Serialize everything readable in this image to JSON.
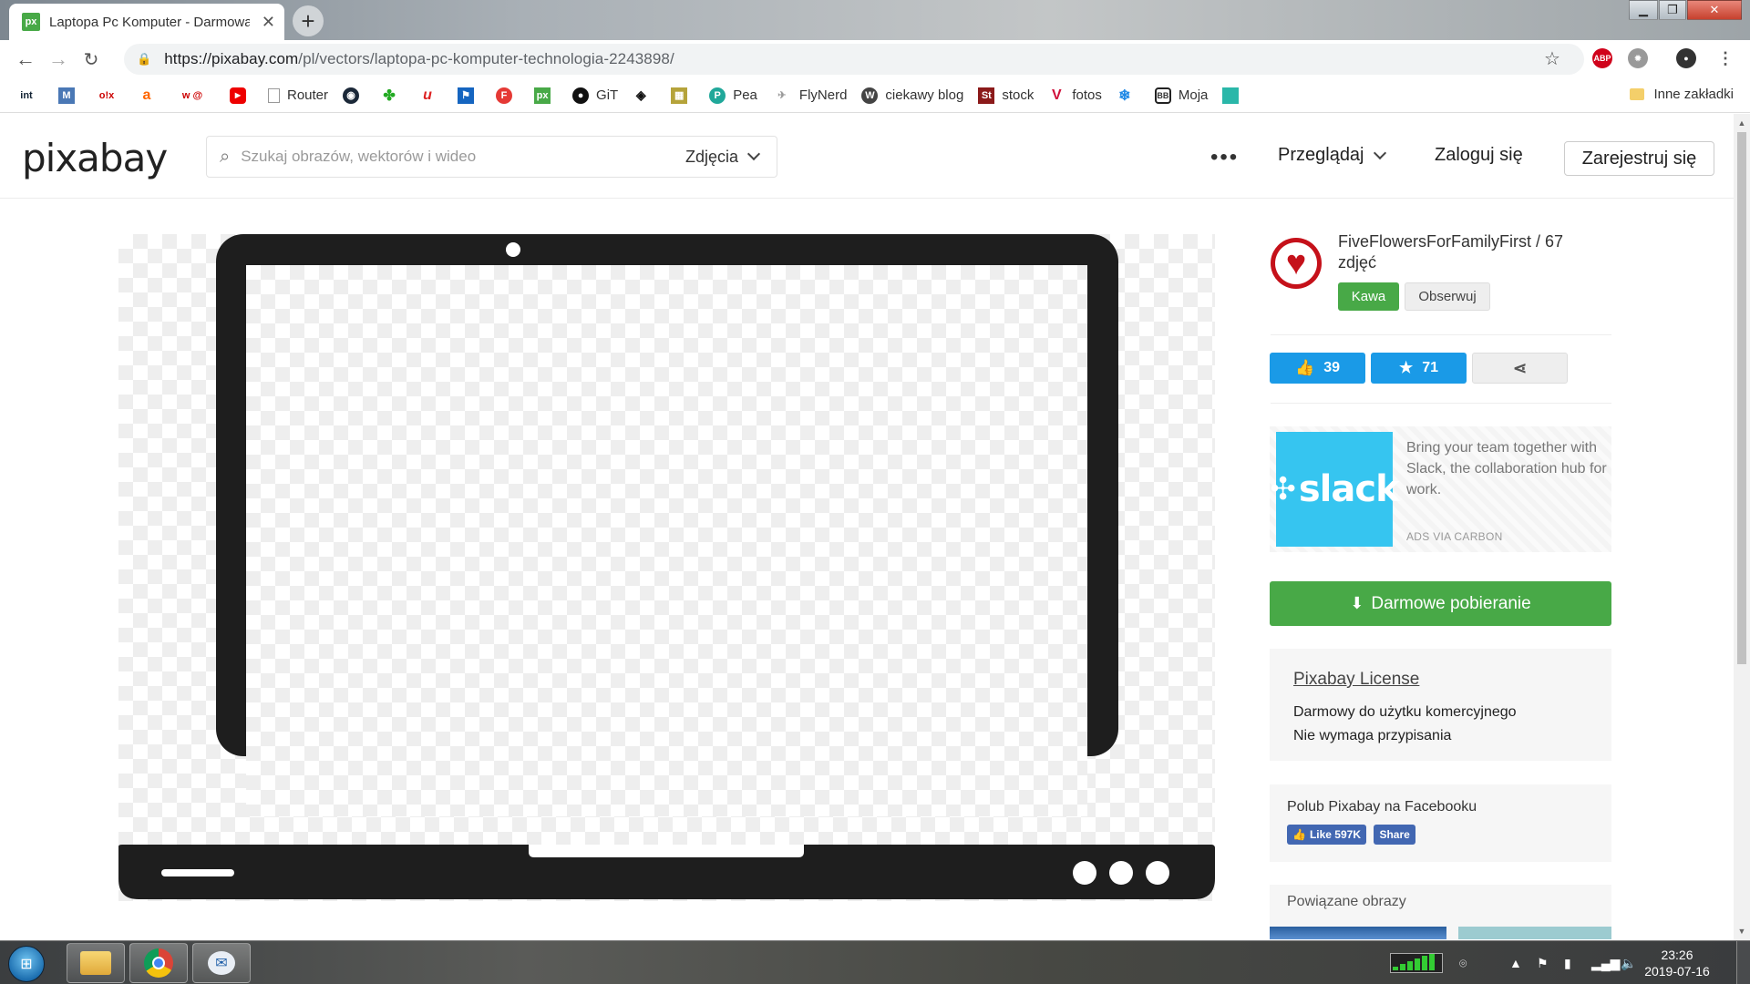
{
  "browser": {
    "tab_title": "Laptopa Pc Komputer - Darmowa",
    "tab_favicon": "px",
    "new_tab": "+",
    "url_host": "https://pixabay.com",
    "url_path": "/pl/vectors/laptopa-pc-komputer-technologia-2243898/",
    "bookmarks": [
      {
        "icon": "int",
        "label": ""
      },
      {
        "icon": "M",
        "label": ""
      },
      {
        "icon": "o!x",
        "label": ""
      },
      {
        "icon": "a",
        "label": ""
      },
      {
        "icon": "w@",
        "label": ""
      },
      {
        "icon": "youtube",
        "label": ""
      },
      {
        "icon": "page",
        "label": "Router"
      },
      {
        "icon": "steam",
        "label": ""
      },
      {
        "icon": "swirl",
        "label": ""
      },
      {
        "icon": "u",
        "label": ""
      },
      {
        "icon": "flag",
        "label": ""
      },
      {
        "icon": "F",
        "label": ""
      },
      {
        "icon": "px",
        "label": ""
      },
      {
        "icon": "github",
        "label": "GiT"
      },
      {
        "icon": "codepen",
        "label": ""
      },
      {
        "icon": "pic",
        "label": ""
      },
      {
        "icon": "P",
        "label": "Pea"
      },
      {
        "icon": "nerd",
        "label": "FlyNerd"
      },
      {
        "icon": "wp",
        "label": "ciekawy blog"
      },
      {
        "icon": "St",
        "label": "stock"
      },
      {
        "icon": "V",
        "label": "fotos"
      },
      {
        "icon": "snow",
        "label": ""
      },
      {
        "icon": "BB",
        "label": "Moja"
      },
      {
        "icon": "teal",
        "label": ""
      }
    ],
    "other_bookmarks": "Inne zakładki"
  },
  "header": {
    "logo": "pixabay",
    "search_placeholder": "Szukaj obrazów, wektorów i wideo",
    "search_type": "Zdjęcia",
    "more": "•••",
    "browse": "Przeglądaj",
    "login": "Zaloguj się",
    "register": "Zarejestruj się"
  },
  "sidebar": {
    "uploader": "FiveFlowersForFamilyFirst / 67 zdjęć",
    "coffee": "Kawa",
    "follow": "Obserwuj",
    "likes": "39",
    "favorites": "71",
    "ad_brand": "slack",
    "ad_text": "Bring your team together with Slack, the collaboration hub for work.",
    "ad_via": "ADS VIA CARBON",
    "download": "Darmowe pobieranie",
    "license_title": "Pixabay License",
    "license_line1": "Darmowy do użytku komercyjnego",
    "license_line2": "Nie wymaga przypisania",
    "fb_title": "Polub Pixabay na Facebooku",
    "fb_like": "Like 597K",
    "fb_share": "Share",
    "related_title": "Powiązane obrazy"
  },
  "taskbar": {
    "time": "23:26",
    "date": "2019-07-16"
  },
  "colors": {
    "brand_green": "#48a947",
    "action_blue": "#1a9ae7",
    "laptop": "#1e1e1e",
    "facebook": "#4267b2"
  }
}
